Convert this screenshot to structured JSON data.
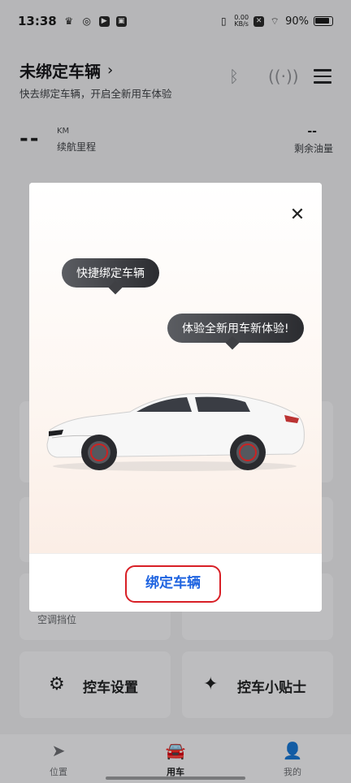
{
  "status_bar": {
    "time": "13:38",
    "net_speed_top": "0.00",
    "net_speed_bottom": "KB/s",
    "battery": "90%",
    "icons": [
      "crown-icon",
      "swirl-icon",
      "app-box-icon",
      "media-box-icon",
      "vibrate-icon",
      "x-icon",
      "wifi-icon",
      "battery-icon"
    ]
  },
  "header": {
    "title": "未绑定车辆",
    "subtitle": "快去绑定车辆，开启全新用车体验",
    "icons": [
      "bluetooth-icon",
      "signal-icon",
      "menu-icon"
    ]
  },
  "stats": {
    "range_value": "--",
    "range_unit": "KM",
    "range_label": "续航里程",
    "fuel_value": "--",
    "fuel_label": "剩余油量"
  },
  "cards": {
    "ac_sub": "空调挡位",
    "control_settings": "控车设置",
    "tips": "控车小贴士"
  },
  "modal": {
    "bubble_1": "快捷绑定车辆",
    "bubble_2": "体验全新用车新体验!",
    "bind_button": "绑定车辆",
    "accent_color": "#1e63e0",
    "highlight_color": "#d81f26"
  },
  "bottom_nav": {
    "items": [
      {
        "label": "位置",
        "icon": "location-arrow-icon",
        "active": false
      },
      {
        "label": "用车",
        "icon": "car-icon",
        "active": true
      },
      {
        "label": "我的",
        "icon": "profile-icon",
        "active": false
      }
    ]
  }
}
